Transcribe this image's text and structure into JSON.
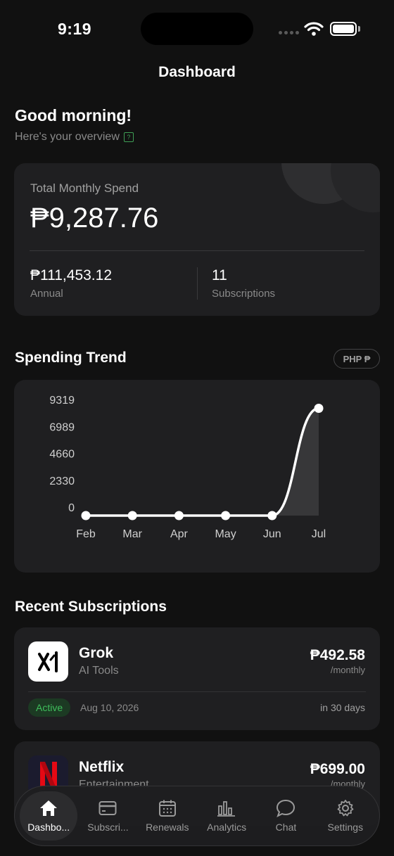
{
  "status_bar": {
    "time": "9:19"
  },
  "nav": {
    "title": "Dashboard"
  },
  "greeting": {
    "title": "Good morning!",
    "subtitle": "Here's your overview"
  },
  "summary": {
    "total_label": "Total Monthly Spend",
    "total_value": "₱9,287.76",
    "annual_value": "₱111,453.12",
    "annual_label": "Annual",
    "subscriptions_value": "11",
    "subscriptions_label": "Subscriptions"
  },
  "trend": {
    "heading": "Spending Trend",
    "currency_pill": "PHP ₱"
  },
  "chart_data": {
    "type": "area",
    "categories": [
      "Feb",
      "Mar",
      "Apr",
      "May",
      "Jun",
      "Jul"
    ],
    "series": [
      {
        "values": [
          0,
          0,
          0,
          0,
          0,
          9287.76
        ]
      }
    ],
    "y_ticks": [
      "9319",
      "6989",
      "4660",
      "2330",
      "0"
    ],
    "ylim": [
      0,
      9319
    ],
    "grid": false,
    "legend": "none",
    "colors": {
      "line": "#ffffff",
      "fill": "#3a3a3c"
    }
  },
  "recent": {
    "heading": "Recent Subscriptions",
    "items": [
      {
        "name": "Grok",
        "category": "AI Tools",
        "price": "₱492.58",
        "period": "/monthly",
        "status": "Active",
        "date": "Aug 10, 2026",
        "renews_in": "in 30 days",
        "icon": "grok-logo"
      },
      {
        "name": "Netflix",
        "category": "Entertainment",
        "price": "₱699.00",
        "period": "/monthly",
        "icon": "netflix-logo"
      }
    ]
  },
  "tabs": [
    {
      "label": "Dashbo...",
      "icon": "home-icon",
      "active": true
    },
    {
      "label": "Subscri...",
      "icon": "card-icon",
      "active": false
    },
    {
      "label": "Renewals",
      "icon": "calendar-icon",
      "active": false
    },
    {
      "label": "Analytics",
      "icon": "chart-icon",
      "active": false
    },
    {
      "label": "Chat",
      "icon": "chat-icon",
      "active": false
    },
    {
      "label": "Settings",
      "icon": "gear-icon",
      "active": false
    }
  ],
  "colors": {
    "background": "#111111",
    "card": "#1f1f21",
    "active_green": "#3fbf5c",
    "netflix_red": "#e50914"
  }
}
